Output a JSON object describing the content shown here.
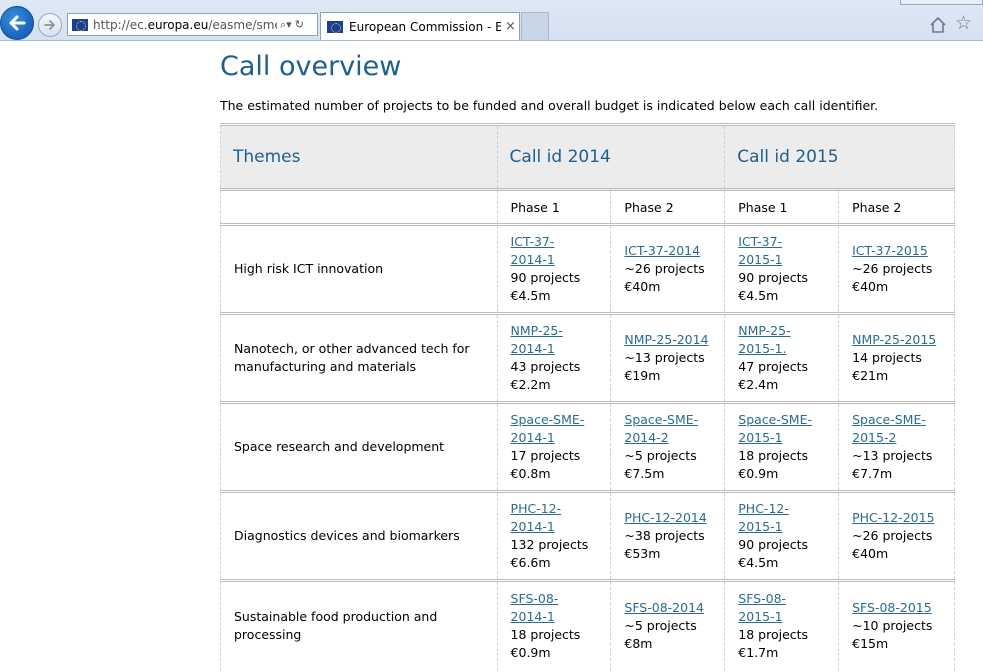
{
  "browser": {
    "url_prefix": "http://ec.",
    "url_domain": "europa.eu",
    "url_path": "/easme/sme",
    "tab_title": "European Commission - Ex...",
    "tab_close": "×"
  },
  "page": {
    "title": "Call overview",
    "intro": "The estimated number of projects to be funded and overall budget is indicated below each call identifier."
  },
  "table": {
    "header": {
      "themes": "Themes",
      "call_2014": "Call id 2014",
      "call_2015": "Call id 2015"
    },
    "phases": [
      "Phase 1",
      "Phase 2",
      "Phase 1",
      "Phase 2"
    ],
    "rows": [
      {
        "theme": "High risk ICT innovation",
        "cells": [
          {
            "link_lines": [
              "ICT-37-",
              "2014-1"
            ],
            "projects": "90 projects",
            "budget": "€4.5m"
          },
          {
            "link_lines": [
              "ICT-37-2014"
            ],
            "projects": "~26 projects",
            "budget": "€40m"
          },
          {
            "link_lines": [
              "ICT-37-",
              "2015-1"
            ],
            "projects": "90 projects",
            "budget": "€4.5m"
          },
          {
            "link_lines": [
              "ICT-37-2015"
            ],
            "projects": "~26 projects",
            "budget": "€40m"
          }
        ]
      },
      {
        "theme_lines": [
          "Nanotech, or other advanced tech for",
          "manufacturing and materials"
        ],
        "cells": [
          {
            "link_lines": [
              "NMP-25-",
              "2014-1"
            ],
            "projects": "43 projects",
            "budget": "€2.2m"
          },
          {
            "link_lines": [
              "NMP-25-2014"
            ],
            "projects": "~13 projects",
            "budget": "€19m"
          },
          {
            "link_lines": [
              "NMP-25-",
              "2015-1."
            ],
            "projects": "47 projects",
            "budget": "€2.4m"
          },
          {
            "link_lines": [
              "NMP-25-2015"
            ],
            "projects": "14 projects",
            "budget": "€21m"
          }
        ]
      },
      {
        "theme": "Space research and development",
        "cells": [
          {
            "link_lines": [
              "Space-SME-",
              "2014-1"
            ],
            "projects": "17 projects",
            "budget": "€0.8m"
          },
          {
            "link_lines": [
              "Space-SME-",
              "2014-2"
            ],
            "projects": "~5 projects",
            "budget": "€7.5m"
          },
          {
            "link_lines": [
              "Space-SME-",
              "2015-1"
            ],
            "projects": "18 projects",
            "budget": "€0.9m"
          },
          {
            "link_lines": [
              "Space-SME-",
              "2015-2"
            ],
            "projects": "~13 projects",
            "budget": "€7.7m"
          }
        ]
      },
      {
        "theme": "Diagnostics devices and biomarkers",
        "cells": [
          {
            "link_lines": [
              "PHC-12-",
              "2014-1"
            ],
            "projects": "132 projects",
            "budget": "€6.6m"
          },
          {
            "link_lines": [
              "PHC-12-2014"
            ],
            "projects": "~38 projects",
            "budget": "€53m"
          },
          {
            "link_lines": [
              "PHC-12-",
              "2015-1"
            ],
            "projects": "90 projects",
            "budget": "€4.5m"
          },
          {
            "link_lines": [
              "PHC-12-2015"
            ],
            "projects": "~26 projects",
            "budget": "€40m"
          }
        ]
      },
      {
        "theme_lines": [
          "Sustainable food production and",
          "processing"
        ],
        "cells": [
          {
            "link_lines": [
              "SFS-08-",
              "2014-1"
            ],
            "projects": "18 projects",
            "budget": "€0.9m"
          },
          {
            "link_lines": [
              "SFS-08-2014"
            ],
            "projects": "~5 projects",
            "budget": "€8m"
          },
          {
            "link_lines": [
              "SFS-08-",
              "2015-1"
            ],
            "projects": "18 projects",
            "budget": "€1.7m"
          },
          {
            "link_lines": [
              "SFS-08-2015"
            ],
            "projects": "~10 projects",
            "budget": "€15m"
          }
        ]
      }
    ]
  },
  "icons": {
    "back": "back-arrow-icon",
    "forward": "forward-arrow-icon",
    "site_flag": "eu-flag-icon",
    "home": "home-icon",
    "favorites": "star-icon"
  },
  "colors": {
    "heading": "#1f5f8e",
    "link": "#2a6c8f",
    "header_bg": "#ececec"
  }
}
